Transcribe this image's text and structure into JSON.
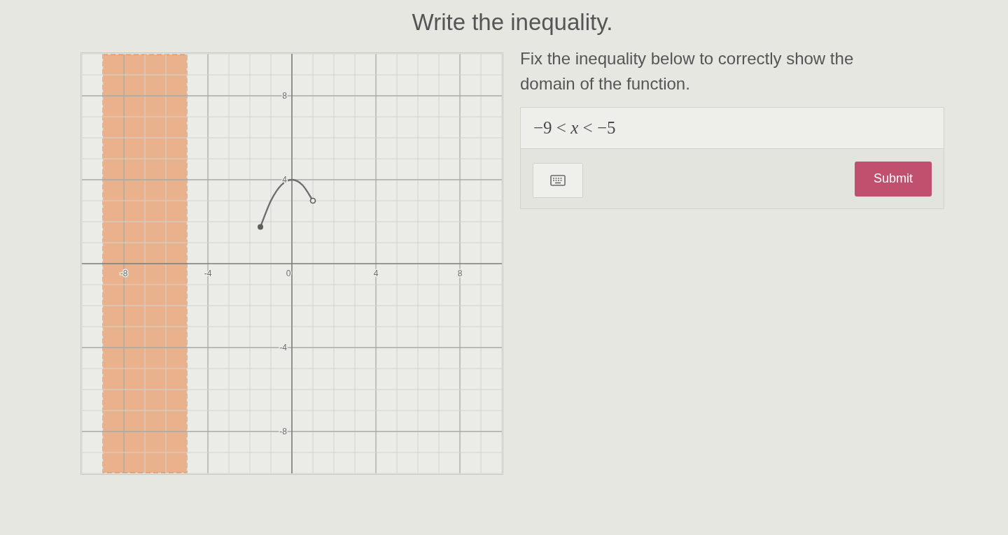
{
  "title": "Write the inequality.",
  "graph": {
    "chart_data": {
      "type": "line",
      "xlim": [
        -10,
        10
      ],
      "ylim": [
        -10,
        10
      ],
      "xticks": [
        -8,
        -4,
        0,
        4,
        8
      ],
      "yticks": [
        -8,
        -4,
        4,
        8
      ],
      "grid": true,
      "x": [
        -1.5,
        -1,
        -0.5,
        0,
        0.5,
        1
      ],
      "series": [
        {
          "color": "#6e6e6e",
          "values": [
            1.75,
            3,
            3.75,
            4,
            3.75,
            3
          ]
        }
      ],
      "bands": [
        {
          "axis": "x",
          "from": -9,
          "to": -5,
          "color": "#e89a66"
        }
      ]
    },
    "curve_ends": {
      "start": {
        "closed": true
      },
      "end": {
        "closed": false
      }
    }
  },
  "question": {
    "prompt": "Fix the inequality below to correctly show the domain of the function.",
    "answer_field": {
      "value": "−9 < *x* < −5"
    }
  },
  "toolbar": {
    "buttons": [
      {
        "kind": "keyboard"
      },
      {
        "kind": "submit",
        "label": "Submit"
      }
    ]
  }
}
